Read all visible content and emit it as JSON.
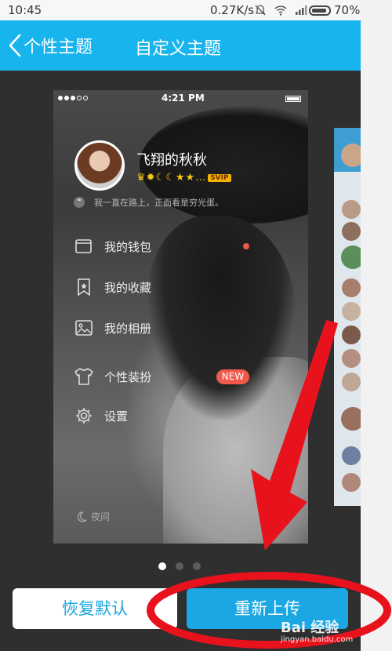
{
  "status_bar": {
    "time": "10:45",
    "network_speed": "0.27K/s",
    "battery_percent": "70%",
    "icons": [
      "mute-icon",
      "wifi-icon",
      "signal-icon",
      "battery-icon"
    ]
  },
  "header": {
    "back_label": "个性主题",
    "title": "自定义主题"
  },
  "preview": {
    "status_time": "4:21 PM",
    "username": "飞翔的秋秋",
    "badge_text": "SVIP",
    "signature": "我一直在路上，正面看是穷光蛋。",
    "menu": [
      {
        "label": "我的钱包",
        "icon": "wallet-icon"
      },
      {
        "label": "我的收藏",
        "icon": "bookmark-icon"
      },
      {
        "label": "我的相册",
        "icon": "photo-icon"
      },
      {
        "label": "个性装扮",
        "icon": "shirt-icon"
      },
      {
        "label": "设置",
        "icon": "gear-icon"
      }
    ],
    "new_badge": "NEW",
    "night_label": "夜间"
  },
  "pagination": {
    "total": 3,
    "current": 1
  },
  "buttons": {
    "restore_default": "恢复默认",
    "reupload": "重新上传"
  },
  "watermark": {
    "brand": "Bai  经验",
    "url": "jingyan.baidu.com"
  },
  "colors": {
    "header_blue": "#18b4ed",
    "button_blue": "#1ba7e3",
    "annotation_red": "#e8121d",
    "badge_red": "#f15a4a"
  }
}
